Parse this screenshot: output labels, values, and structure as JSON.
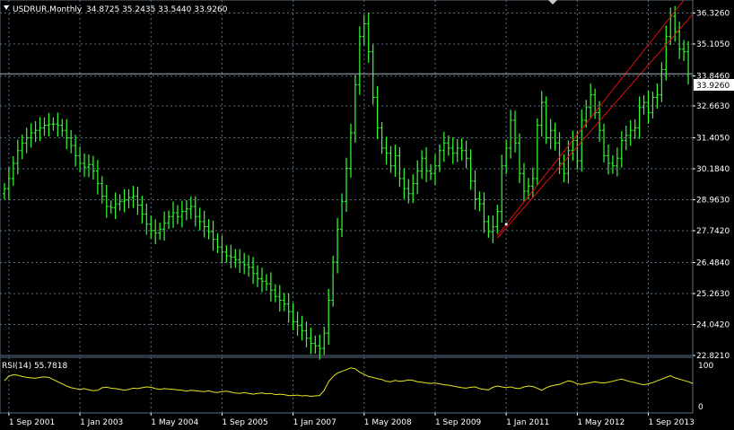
{
  "window": {
    "symbol": "USDRUR,Monthly",
    "ohlc_text": "34.8725 35.2435 33.5440 33.9260",
    "current_price_label": "33.9260"
  },
  "indicator": {
    "label": "RSI(14) 55.7818",
    "levels": [
      "100",
      "0"
    ]
  },
  "colors": {
    "background": "#000000",
    "grid": "#5a6e82",
    "bars": "#33ff33",
    "trendlines": "#e01010",
    "rsi_line": "#e6e61e",
    "text": "#ffffff"
  },
  "chart_data": {
    "type": "bar",
    "title": "USDRUR,Monthly",
    "price_ticks": [
      "36.3260",
      "35.1050",
      "33.8460",
      "32.6630",
      "31.4050",
      "30.1840",
      "28.9630",
      "27.7420",
      "26.4840",
      "25.2630",
      "24.0420",
      "22.8210"
    ],
    "ylim": [
      22.821,
      36.84
    ],
    "x_ticks": [
      "1 Sep 2001",
      "1 Jan 2003",
      "1 May 2004",
      "1 Sep 2005",
      "1 Jan 2007",
      "1 May 2008",
      "1 Sep 2009",
      "1 Jan 2011",
      "1 May 2012",
      "1 Sep 2013"
    ],
    "x_range": [
      "2001-07",
      "2014-07"
    ],
    "period_start": "2001-08",
    "closes": [
      29.4,
      29.8,
      30.4,
      30.9,
      31.2,
      31.4,
      31.6,
      31.7,
      31.8,
      31.9,
      31.95,
      31.95,
      31.9,
      31.7,
      31.4,
      31.1,
      30.7,
      30.4,
      30.25,
      30.35,
      30.1,
      29.6,
      29.1,
      28.7,
      28.65,
      28.8,
      28.9,
      28.95,
      29.05,
      29.1,
      28.75,
      28.4,
      28.0,
      27.75,
      27.65,
      27.8,
      28.05,
      28.3,
      28.45,
      28.3,
      28.5,
      28.6,
      28.7,
      28.3,
      28.1,
      27.9,
      27.7,
      27.4,
      27.1,
      26.9,
      26.75,
      26.7,
      26.6,
      26.5,
      26.4,
      26.3,
      26.05,
      25.85,
      25.75,
      25.65,
      25.4,
      25.15,
      25.0,
      24.85,
      24.55,
      24.15,
      24.0,
      23.8,
      23.5,
      23.3,
      23.2,
      23.1,
      23.7,
      25.0,
      26.5,
      27.8,
      28.9,
      30.2,
      31.6,
      33.5,
      35.4,
      35.9,
      34.8,
      33.0,
      31.8,
      31.0,
      30.8,
      30.3,
      30.7,
      29.8,
      29.4,
      29.2,
      29.6,
      30.1,
      30.6,
      30.1,
      30.0,
      30.3,
      30.9,
      31.2,
      31.0,
      30.8,
      31.0,
      30.9,
      30.6,
      29.7,
      29.0,
      28.8,
      28.1,
      27.7,
      27.9,
      28.5,
      30.3,
      31.0,
      32.1,
      31.2,
      30.0,
      29.3,
      29.5,
      29.8,
      31.9,
      32.8,
      31.4,
      31.7,
      31.2,
      30.4,
      30.0,
      30.9,
      31.3,
      30.5,
      32.1,
      32.6,
      33.1,
      32.4,
      31.7,
      30.7,
      30.4,
      30.3,
      30.6,
      31.3,
      31.5,
      31.7,
      31.8,
      32.6,
      32.8,
      32.4,
      33.0,
      33.1,
      34.1,
      35.4,
      36.2,
      35.6,
      34.9,
      34.8,
      33.93
    ],
    "monthly_range_sd": 0.45,
    "rsi": {
      "name": "RSI(14)",
      "ylim": [
        0,
        100
      ],
      "last_value": 55.7818,
      "values": [
        62,
        73,
        76,
        75,
        72,
        70,
        69,
        68,
        70,
        71,
        70,
        65,
        60,
        55,
        50,
        46,
        44,
        42,
        44,
        41,
        39,
        40,
        46,
        47,
        45,
        44,
        42,
        40,
        42,
        45,
        44,
        46,
        48,
        47,
        44,
        42,
        44,
        43,
        42,
        41,
        40,
        38,
        40,
        39,
        38,
        37,
        39,
        36,
        35,
        37,
        38,
        36,
        34,
        33,
        35,
        33,
        31,
        33,
        34,
        32,
        33,
        30,
        31,
        30,
        28,
        28,
        29,
        27,
        28,
        26,
        27,
        28,
        40,
        60,
        72,
        80,
        84,
        88,
        92,
        90,
        82,
        77,
        72,
        70,
        67,
        65,
        61,
        60,
        63,
        61,
        62,
        64,
        63,
        60,
        59,
        57,
        56,
        57,
        55,
        53,
        52,
        50,
        48,
        46,
        45,
        47,
        48,
        44,
        42,
        41,
        47,
        50,
        48,
        46,
        48,
        45,
        44,
        48,
        50,
        49,
        45,
        40,
        46,
        50,
        52,
        54,
        58,
        62,
        60,
        55,
        54,
        56,
        58,
        60,
        58,
        57,
        59,
        61,
        64,
        66,
        63,
        60,
        58,
        55,
        53,
        55,
        58,
        62,
        66,
        70,
        74,
        69,
        66,
        63,
        60,
        56
      ]
    },
    "trendlines": [
      {
        "from": [
          "2010-11",
          27.55
        ],
        "to": [
          "2014-05",
          36.84
        ]
      },
      {
        "from": [
          "2010-11",
          27.45
        ],
        "to": [
          "2014-07",
          36.28
        ]
      }
    ],
    "grid": true
  }
}
